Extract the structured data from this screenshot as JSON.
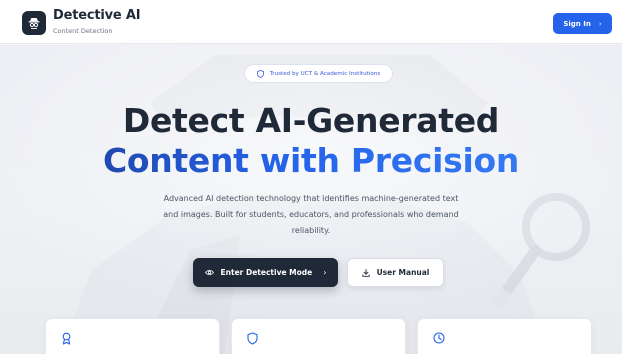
{
  "header": {
    "brand_title": "Detective AI",
    "brand_subtitle": "Content Detection",
    "logo_icon": "detective-icon",
    "signin_label": "Sign In",
    "signin_icon": "chevron-right-icon"
  },
  "hero": {
    "badge_text": "Trusted by UCT & Academic Institutions",
    "badge_icon": "shield-icon",
    "headline_line1": "Detect AI-Generated",
    "headline_line2": "Content with Precision",
    "subtitle": "Advanced AI detection technology that identifies machine-generated text and images. Built for students, educators, and professionals who demand reliability.",
    "primary_cta_label": "Enter Detective Mode",
    "primary_cta_icon": "eye-icon",
    "secondary_cta_label": "User Manual",
    "secondary_cta_icon": "download-icon"
  },
  "features": [
    {
      "icon": "award-icon"
    },
    {
      "icon": "shield-icon"
    },
    {
      "icon": "clock-icon"
    }
  ],
  "colors": {
    "accent": "#2563eb",
    "dark": "#1f2937",
    "badge_text": "#3b5bd9"
  }
}
